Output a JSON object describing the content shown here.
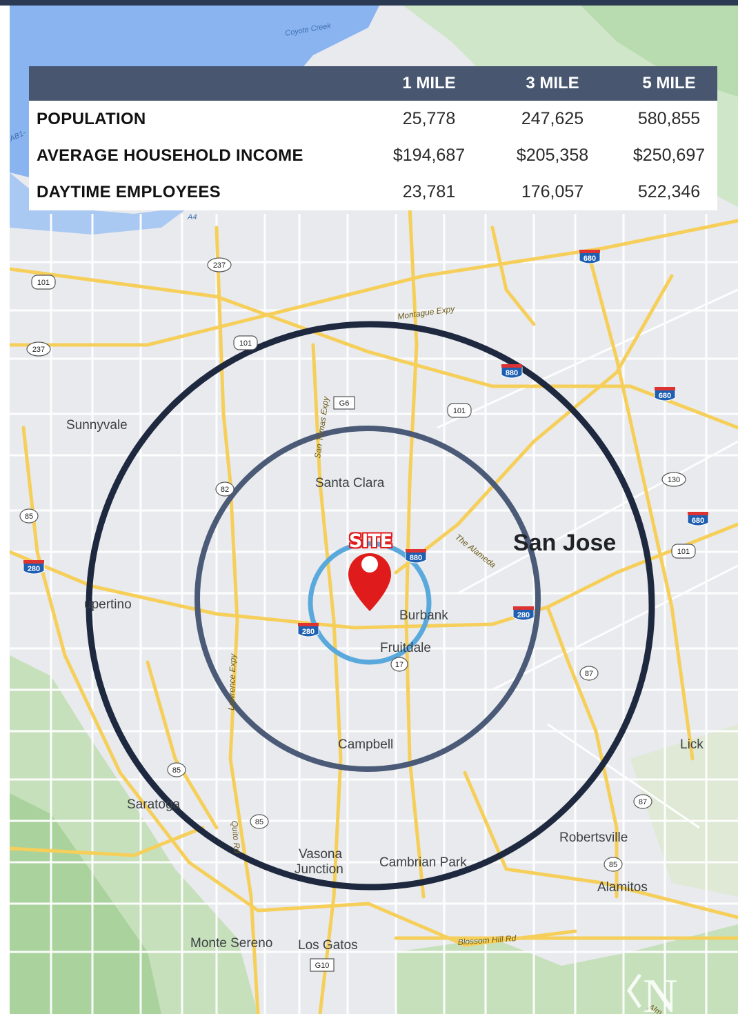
{
  "stats": {
    "headers": [
      "",
      "1 MILE",
      "3 MILE",
      "5 MILE"
    ],
    "rows": [
      {
        "label": "POPULATION",
        "values": [
          "25,778",
          "247,625",
          "580,855"
        ]
      },
      {
        "label": "AVERAGE HOUSEHOLD INCOME",
        "values": [
          "$194,687",
          "$205,358",
          "$250,697"
        ]
      },
      {
        "label": "DAYTIME EMPLOYEES",
        "values": [
          "23,781",
          "176,057",
          "522,346"
        ]
      }
    ]
  },
  "site": {
    "label": "SITE",
    "pin_color": "#e01b1b"
  },
  "rings": {
    "one_mile_color": "#5aa9dc",
    "three_mile_color": "#4b5a76",
    "five_mile_color": "#1e2940"
  },
  "map": {
    "places": {
      "san_jose": "San Jose",
      "sunnyvale": "Sunnyvale",
      "santa_clara": "Santa Clara",
      "cupertino": "upertino",
      "burbank": "Burbank",
      "fruitdale": "Fruitdale",
      "campbell": "Campbell",
      "saratoga": "Saratoga",
      "vasona1": "Vasona",
      "vasona2": "Junction",
      "cambrian_park": "Cambrian Park",
      "robertsville": "Robertsville",
      "alamitos": "Alamitos",
      "lick": "Lick",
      "monte_sereno": "Monte Sereno",
      "los_gatos": "Los Gatos"
    },
    "roads": {
      "coyote_creek": "Coyote Creek",
      "montague": "Montague Expy",
      "san_tomas": "San Tomas Expy",
      "lawrence": "Lawrence Expy",
      "alameda": "The Alameda",
      "blossom_hill": "Blossom Hill Rd",
      "quito": "Quito Rd",
      "a4": "A4",
      "ab1": "AB1-",
      "alm": "Alm"
    },
    "shields": {
      "us101": "101",
      "sr237": "237",
      "sr82": "82",
      "sr85": "85",
      "sr87": "87",
      "sr17": "17",
      "sr130": "130",
      "i280": "280",
      "i880": "880",
      "i680": "680",
      "g6": "G6",
      "g10": "G10"
    }
  },
  "logo": {
    "glyph": "N"
  }
}
